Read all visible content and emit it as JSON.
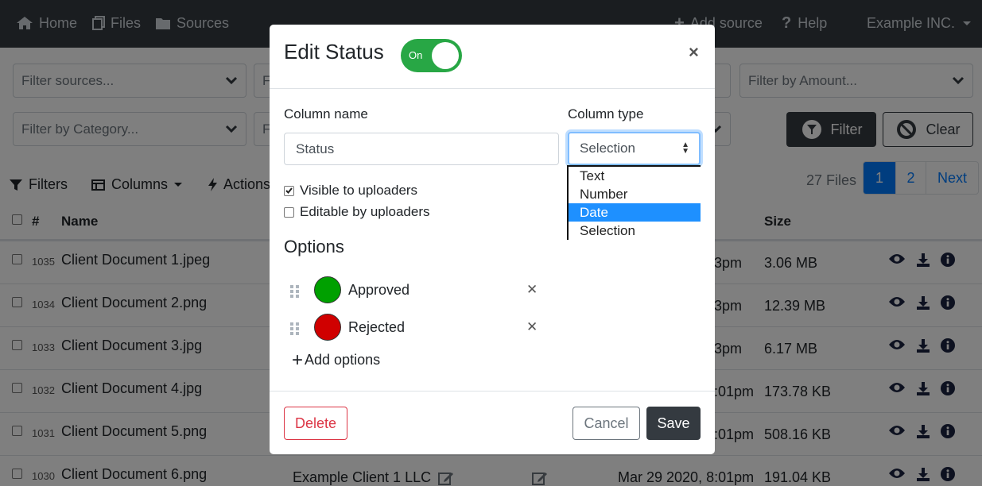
{
  "navbar": {
    "home": "Home",
    "files": "Files",
    "sources": "Sources",
    "add_source": "Add source",
    "help": "Help",
    "account": "Example INC."
  },
  "filters": {
    "sources_placeholder": "Filter sources...",
    "category_placeholder": "Filter by Category...",
    "amount_placeholder": "Filter by Amount...",
    "clipped_1": "F",
    "clipped_2": "F",
    "filter_button": "Filter",
    "clear_button": "Clear"
  },
  "toolbar": {
    "filters": "Filters",
    "columns": "Columns",
    "actions": "Actions",
    "files_count": "27 Files",
    "pages": [
      "1",
      "2"
    ],
    "next": "Next"
  },
  "table": {
    "headers": {
      "num": "#",
      "name": "Name",
      "size": "Size"
    },
    "rows": [
      {
        "num": "1035",
        "name": "Client Document 1.jpeg",
        "time": "3pm",
        "size": "3.06 MB"
      },
      {
        "num": "1034",
        "name": "Client Document 2.png",
        "time": "3pm",
        "size": "12.39 MB"
      },
      {
        "num": "1033",
        "name": "Client Document 3.jpg",
        "time": "3pm",
        "size": "6.17 MB"
      },
      {
        "num": "1032",
        "name": "Client Document 4.jpg",
        "time": ":01pm",
        "size": "173.78 KB"
      },
      {
        "num": "1031",
        "name": "Client Document 5.png",
        "time": ":01pm",
        "size": "508.16 KB"
      },
      {
        "num": "1030",
        "name": "Client Document 6.png",
        "client": "Example Client 1 LLC",
        "date": "Mar 29 2020, 8:01pm",
        "size": "191.04 KB"
      }
    ]
  },
  "modal": {
    "title": "Edit Status",
    "toggle_label": "On",
    "close": "×",
    "column_name_label": "Column name",
    "column_name_value": "Status",
    "column_type_label": "Column type",
    "column_type_value": "Selection",
    "column_type_options": [
      "Text",
      "Number",
      "Date",
      "Selection"
    ],
    "column_type_highlighted": "Date",
    "visible_to_uploaders": "Visible to uploaders",
    "visible_checked": true,
    "editable_by_uploaders": "Editable by uploaders",
    "editable_checked": false,
    "options_title": "Options",
    "options": [
      {
        "label": "Approved",
        "color": "#00a000"
      },
      {
        "label": "Rejected",
        "color": "#d00000"
      }
    ],
    "add_options": "Add options",
    "delete": "Delete",
    "cancel": "Cancel",
    "save": "Save"
  },
  "colors": {
    "navbar_bg": "#343a40",
    "primary": "#007bff",
    "toggle_on": "#28a745",
    "danger": "#dc3545"
  }
}
